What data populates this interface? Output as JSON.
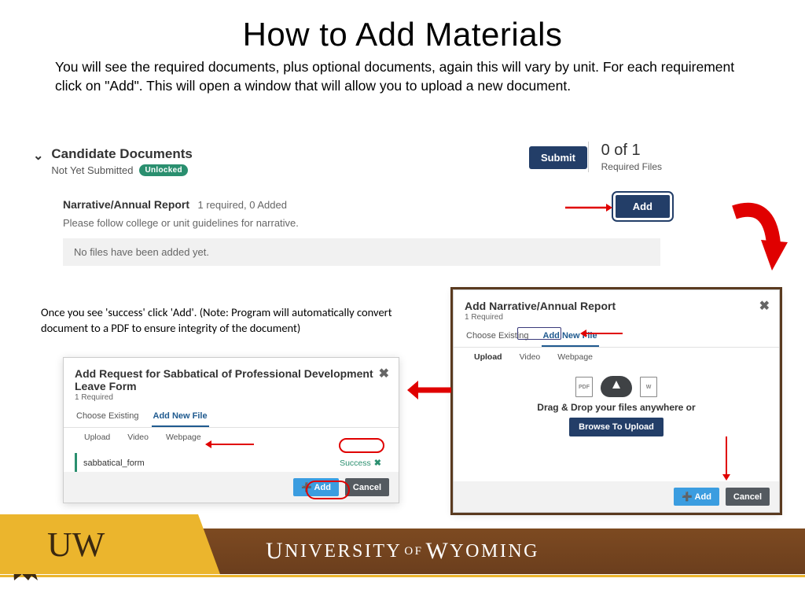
{
  "title": "How to Add Materials",
  "subtitle": "You will see the required documents, plus optional documents, again this will vary by unit. For each requirement click on \"Add\". This will open a window that will allow you to upload a new  document.",
  "panel_a": {
    "heading": "Candidate Documents",
    "status": "Not Yet Submitted",
    "badge": "Unlocked",
    "submit": "Submit",
    "req_count": "0 of 1",
    "req_label": "Required Files",
    "add": "Add",
    "section_title": "Narrative/Annual Report",
    "section_meta": "1 required, 0 Added",
    "section_desc": "Please follow college or unit guidelines for narrative.",
    "no_files": "No files have been added yet."
  },
  "note": "Once you see 'success' click 'Add'. (Note: Program will automatically convert document to a PDF to ensure integrity of the document)",
  "dialog_b": {
    "title": "Add Narrative/Annual Report",
    "req": "1 Required",
    "tabs": {
      "choose": "Choose Existing",
      "addnew": "Add New File"
    },
    "subtabs": {
      "upload": "Upload",
      "video": "Video",
      "webpage": "Webpage"
    },
    "drop_text": "Drag & Drop your files anywhere or",
    "browse": "Browse To Upload",
    "add": "Add",
    "cancel": "Cancel",
    "pdf_label": "PDF",
    "doc_label": "W"
  },
  "dialog_c": {
    "title": "Add Request for Sabbatical of Professional Development Leave Form",
    "req": "1 Required",
    "tabs": {
      "choose": "Choose Existing",
      "addnew": "Add New File"
    },
    "subtabs": {
      "upload": "Upload",
      "video": "Video",
      "webpage": "Webpage"
    },
    "file": "sabbatical_form",
    "success": "Success",
    "add": "Add",
    "cancel": "Cancel"
  },
  "footer": {
    "u": "U",
    "niversity": "NIVERSITY",
    "of": "OF",
    "w": "W",
    "yoming": "YOMING",
    "logo_u": "U",
    "logo_w": "W"
  }
}
